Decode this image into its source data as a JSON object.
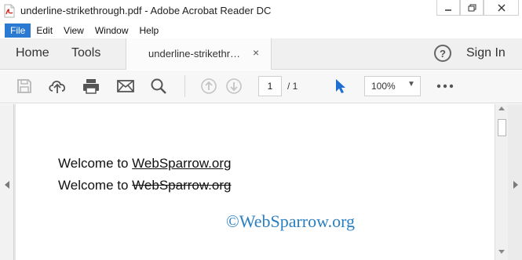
{
  "window": {
    "title": "underline-strikethrough.pdf - Adobe Acrobat Reader DC",
    "controls": [
      "minimize-icon",
      "maximize-icon",
      "close-icon"
    ]
  },
  "menu": [
    "File",
    "Edit",
    "View",
    "Window",
    "Help"
  ],
  "tabs": {
    "home": "Home",
    "tools": "Tools",
    "document": "underline-strikethrough.pdf",
    "document_display": "underline-strikethr…",
    "close_glyph": "×",
    "help_glyph": "?",
    "sign_in": "Sign In"
  },
  "toolbar": {
    "icons": [
      "save-icon",
      "upload-icon",
      "print-icon",
      "email-icon",
      "search-icon",
      "page-up-icon",
      "page-down-icon",
      "select-cursor-icon",
      "more-icon"
    ],
    "page_current": "1",
    "page_total": "/ 1",
    "zoom": "100%"
  },
  "document": {
    "line1_prefix": "Welcome to ",
    "line1_link": "WebSparrow.org",
    "line2_prefix": "Welcome to ",
    "line2_struck": "WebSparrow.org",
    "watermark": "©WebSparrow.org"
  },
  "colors": {
    "accent": "#2a7ad2",
    "watermark": "#2a7fc1",
    "cursor": "#1f6fd1"
  }
}
